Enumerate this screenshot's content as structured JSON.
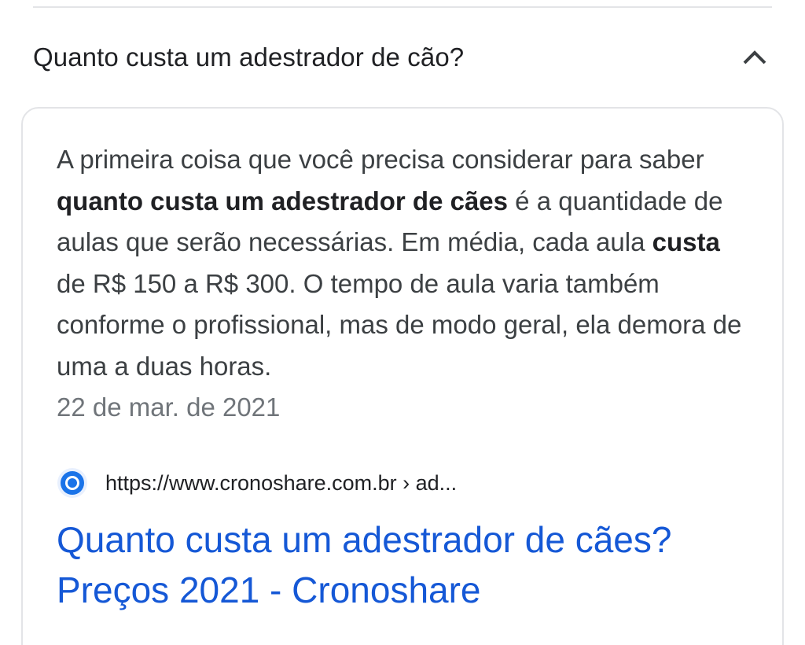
{
  "faq": {
    "question": "Quanto custa um adestrador de cão?",
    "expanded_icon": "chevron-up-icon"
  },
  "answer": {
    "segments": [
      {
        "text": "A primeira coisa que você precisa considerar para saber ",
        "bold": false
      },
      {
        "text": "quanto custa um adestrador de cães",
        "bold": true
      },
      {
        "text": " é a quantidade de aulas que serão necessárias. Em média, cada aula ",
        "bold": false
      },
      {
        "text": "custa",
        "bold": true
      },
      {
        "text": " de R$ 150 a R$ 300. O tempo de aula varia também conforme o profissional, mas de modo geral, ela demora de uma a duas horas.",
        "bold": false
      }
    ],
    "date": "22 de mar. de 2021"
  },
  "source": {
    "favicon": "cronoshare-favicon-icon",
    "url": "https://www.cronoshare.com.br › ad...",
    "title": "Quanto custa um adestrador de cães? Preços 2021 - Cronoshare"
  },
  "colors": {
    "link": "#1558d6",
    "text": "#3c4043",
    "muted": "#70757a",
    "border": "#e3e4e7",
    "favicon": "#1a73e8"
  }
}
